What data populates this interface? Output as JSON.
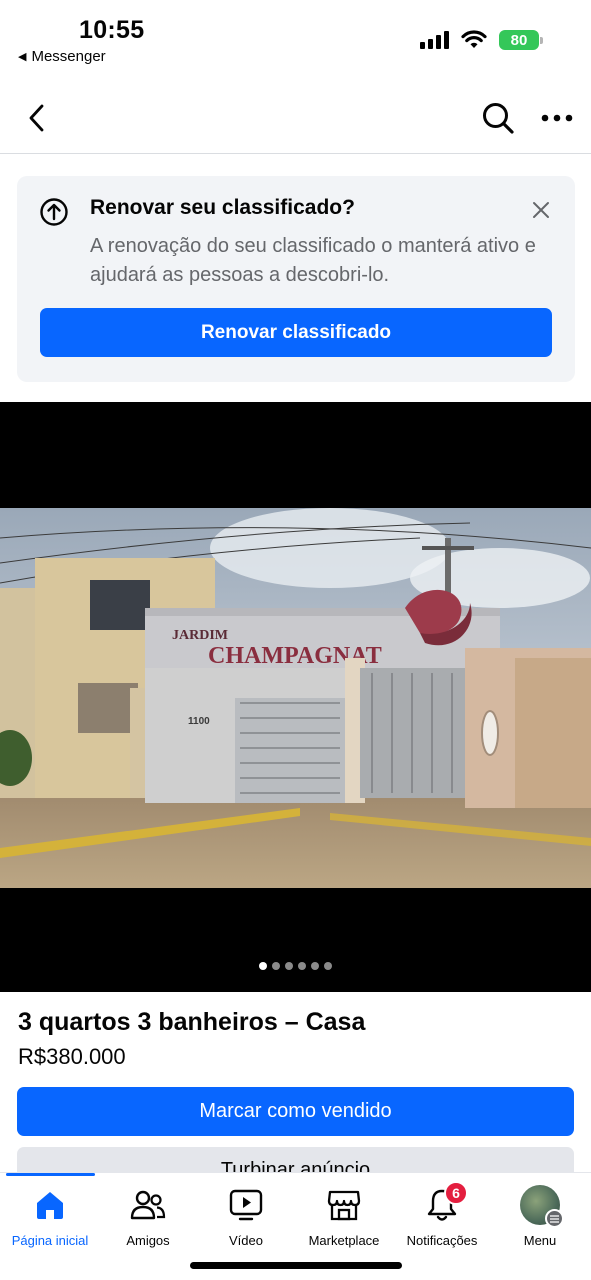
{
  "status_bar": {
    "time": "10:55",
    "back_app": "Messenger",
    "battery": "80",
    "battery_color": "#34c759"
  },
  "nav": {
    "back_icon": "chevron-left-icon",
    "search_icon": "search-icon",
    "more_icon": "more-horizontal-icon"
  },
  "renew": {
    "title": "Renovar seu classificado?",
    "text": "A renovação do seu classificado o manterá ativo e ajudará as pessoas a descobri-lo.",
    "button": "Renovar classificado",
    "icon": "arrow-up-circle-icon",
    "close_icon": "close-icon"
  },
  "photo": {
    "sign_line1": "JARDIM",
    "sign_line2": "CHAMPAGNAT",
    "house_number": "1100",
    "dots_total": 6,
    "dots_active": 0
  },
  "listing": {
    "title": "3 quartos 3 banheiros – Casa",
    "price": "R$380.000",
    "sold_button": "Marcar como vendido",
    "boost_button": "Turbinar anúncio"
  },
  "tabs": [
    {
      "label": "Página inicial",
      "icon": "home-icon",
      "active": true
    },
    {
      "label": "Amigos",
      "icon": "friends-icon",
      "active": false
    },
    {
      "label": "Vídeo",
      "icon": "video-icon",
      "active": false
    },
    {
      "label": "Marketplace",
      "icon": "marketplace-icon",
      "active": false
    },
    {
      "label": "Notificações",
      "icon": "bell-icon",
      "active": false,
      "badge": "6"
    },
    {
      "label": "Menu",
      "icon": "avatar",
      "active": false
    }
  ],
  "colors": {
    "brand_blue": "#0866ff",
    "badge_red": "#e41e3f",
    "card_bg": "#f2f4f7",
    "secondary_text": "#65676b"
  }
}
